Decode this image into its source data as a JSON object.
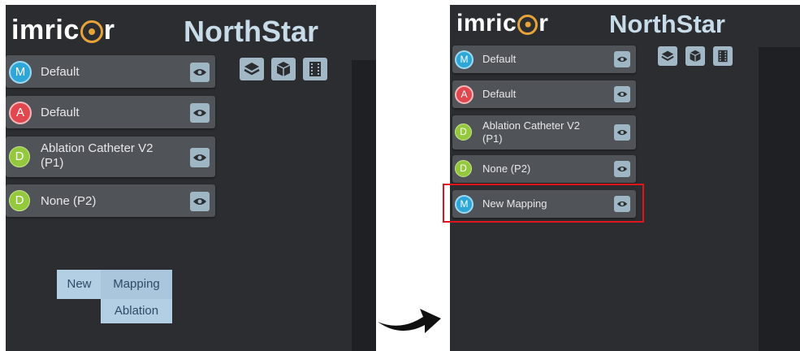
{
  "app": {
    "logo_text_pre": "imric",
    "logo_text_post": "r",
    "brand": "NorthStar"
  },
  "toolbar": {
    "icons": [
      "layers-icon",
      "cube-icon",
      "film-icon"
    ]
  },
  "before": {
    "layers": [
      {
        "badge": "M",
        "label": "Default"
      },
      {
        "badge": "A",
        "label": "Default"
      },
      {
        "badge": "D",
        "label": "Ablation Catheter V2 (P1)"
      },
      {
        "badge": "D",
        "label": "None (P2)"
      }
    ],
    "context_menu": {
      "new_label": "New",
      "options": [
        "Mapping",
        "Ablation"
      ]
    }
  },
  "after": {
    "layers": [
      {
        "badge": "M",
        "label": "Default"
      },
      {
        "badge": "A",
        "label": "Default"
      },
      {
        "badge": "D",
        "label": "Ablation Catheter V2 (P1)"
      },
      {
        "badge": "D",
        "label": "None (P2)"
      },
      {
        "badge": "M",
        "label": "New Mapping"
      }
    ]
  },
  "colors": {
    "highlight": "#e0141e",
    "badge_m": "#2ea7d8",
    "badge_a": "#e0474e",
    "badge_d": "#94c83d"
  }
}
